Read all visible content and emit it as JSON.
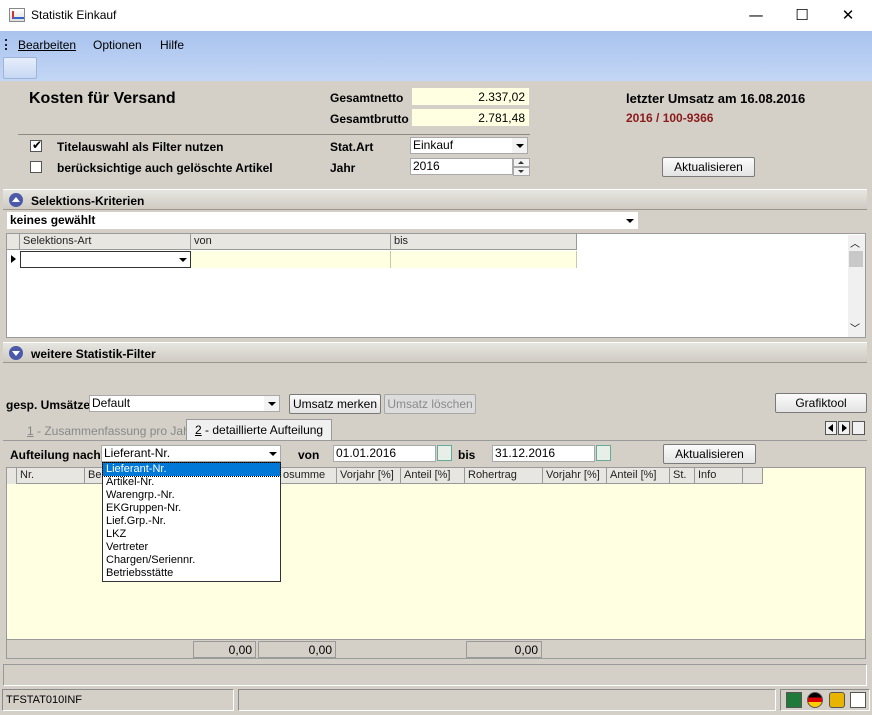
{
  "window": {
    "title": "Statistik Einkauf",
    "minimize": "—",
    "maximize": "☐",
    "close": "✕"
  },
  "menu": {
    "items": [
      "Bearbeiten",
      "Optionen",
      "Hilfe"
    ]
  },
  "header": {
    "title": "Kosten für Versand",
    "gesamtnetto_label": "Gesamtnetto",
    "gesamtnetto_value": "2.337,02",
    "gesamtbrutto_label": "Gesamtbrutto",
    "gesamtbrutto_value": "2.781,48",
    "letzter_umsatz": "letzter Umsatz am 16.08.2016",
    "beleg": "2016 / 100-9366",
    "chk_titelauswahl": "Titelauswahl als Filter nutzen",
    "chk_titelauswahl_checked": true,
    "chk_geloeschte": "berücksichtige auch gelöschte Artikel",
    "chk_geloeschte_checked": false,
    "statart_label": "Stat.Art",
    "statart_value": "Einkauf",
    "jahr_label": "Jahr",
    "jahr_value": "2016",
    "aktualisieren": "Aktualisieren"
  },
  "selektion": {
    "title": "Selektions-Kriterien",
    "combo_value": "keines gewählt",
    "columns": [
      "Selektions-Art",
      "von",
      "bis"
    ]
  },
  "weitere": {
    "title": "weitere Statistik-Filter"
  },
  "umsaetze": {
    "label": "gesp. Umsätze",
    "value": "Default",
    "merken": "Umsatz merken",
    "loeschen": "Umsatz löschen",
    "grafiktool": "Grafiktool"
  },
  "tabs": [
    {
      "key": "1",
      "label": " - Zusammenfassung pro Jahr"
    },
    {
      "key": "2",
      "label": " - detaillierte Aufteilung"
    }
  ],
  "aufteilung": {
    "label": "Aufteilung nach",
    "value": "Lieferant-Nr.",
    "von_label": "von",
    "von_value": "01.01.2016",
    "bis_label": "bis",
    "bis_value": "31.12.2016",
    "aktualisieren": "Aktualisieren",
    "options": [
      "Lieferant-Nr.",
      "Artikel-Nr.",
      "Warengrp.-Nr.",
      "EKGruppen-Nr.",
      "Lief.Grp.-Nr.",
      "LKZ",
      "Vertreter",
      "Chargen/Seriennr.",
      "Betriebsstätte"
    ]
  },
  "result_grid": {
    "columns": [
      "Nr.",
      "Be",
      "osumme",
      "Vorjahr [%]",
      "Anteil [%]",
      "Rohertrag",
      "Vorjahr [%]",
      "Anteil [%]",
      "St.",
      "Info"
    ],
    "totals": [
      "0,00",
      "0,00",
      "0,00"
    ]
  },
  "status": {
    "code": "TFSTAT010INF"
  }
}
